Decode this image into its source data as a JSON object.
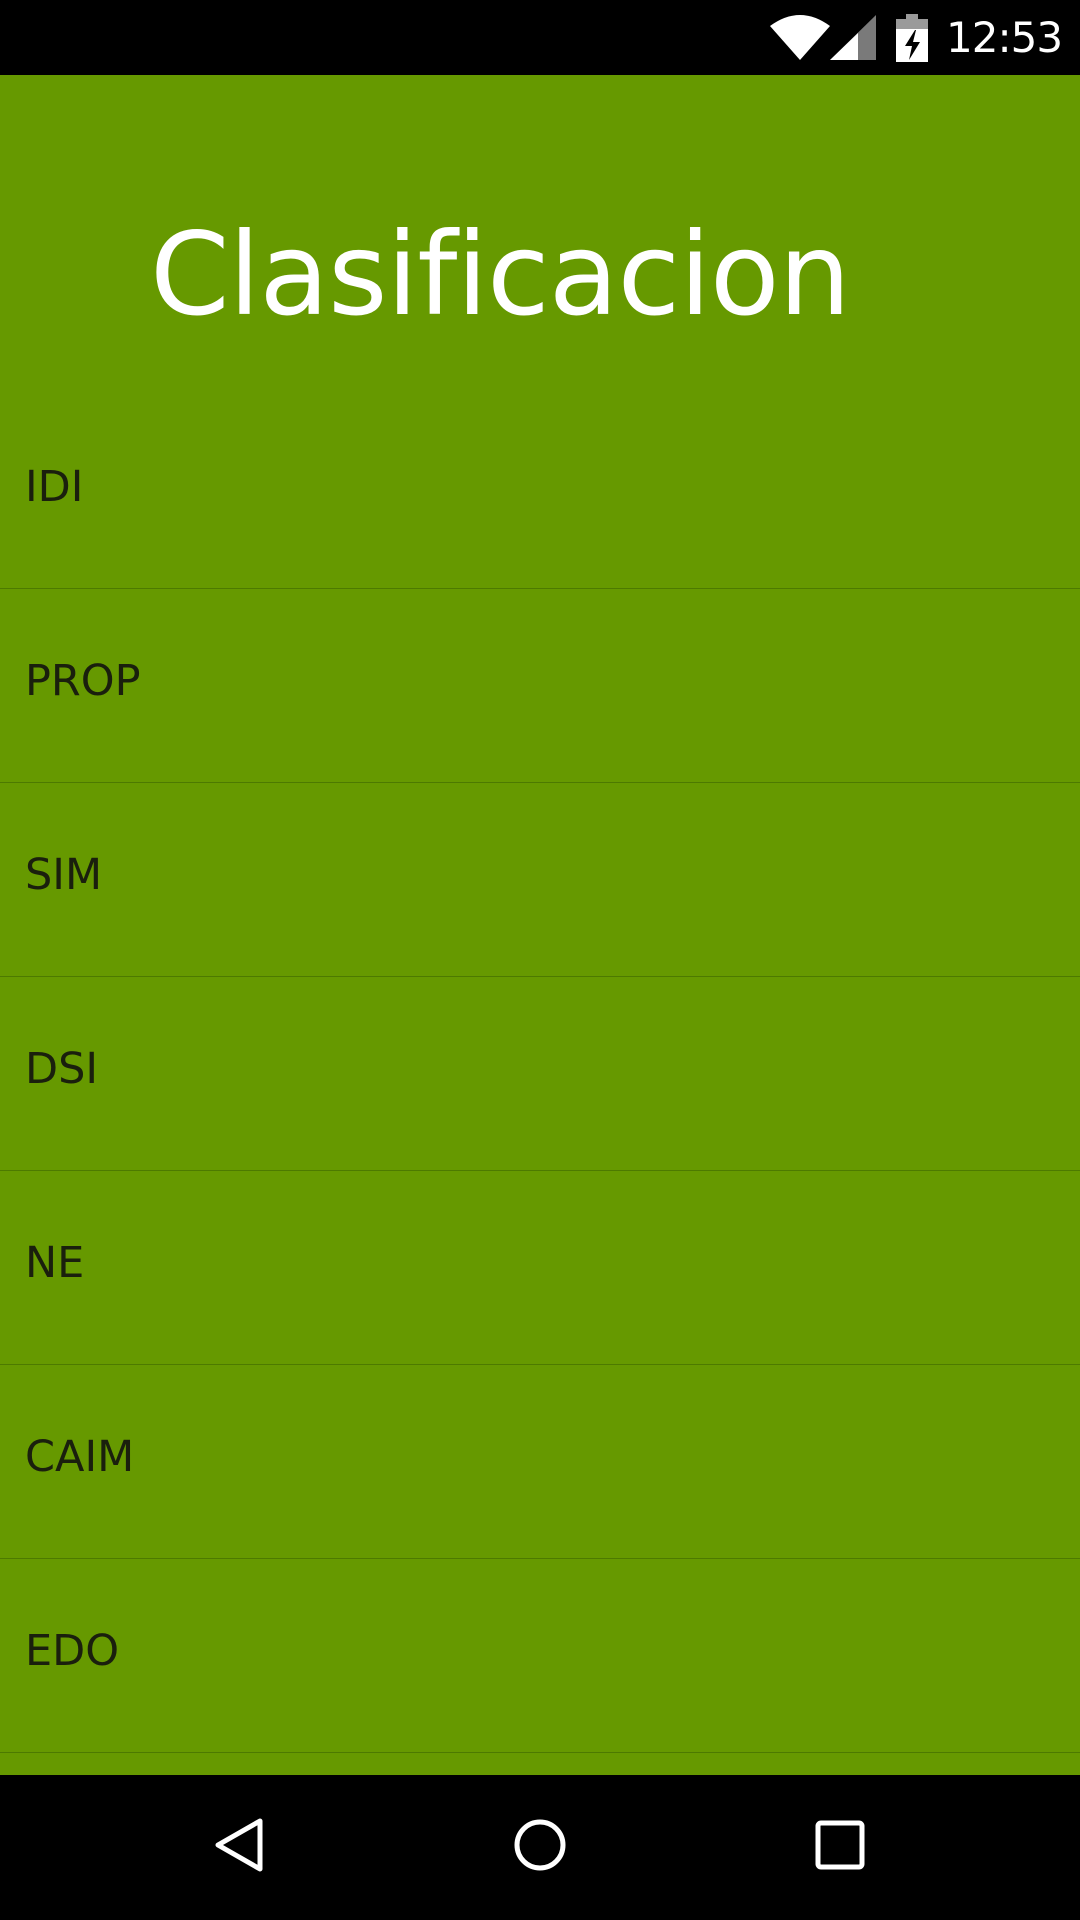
{
  "status_bar": {
    "time": "12:53",
    "icons": [
      "wifi-icon",
      "cell-signal-icon",
      "battery-charging-icon"
    ]
  },
  "app": {
    "title": "Clasificacion",
    "background_color": "#669900",
    "items": [
      {
        "label": "IDI"
      },
      {
        "label": "PROP"
      },
      {
        "label": "SIM"
      },
      {
        "label": "DSI"
      },
      {
        "label": "NE"
      },
      {
        "label": "CAIM"
      },
      {
        "label": "EDO"
      }
    ]
  },
  "nav_bar": {
    "icons": [
      "back-icon",
      "home-icon",
      "recent-apps-icon"
    ]
  }
}
